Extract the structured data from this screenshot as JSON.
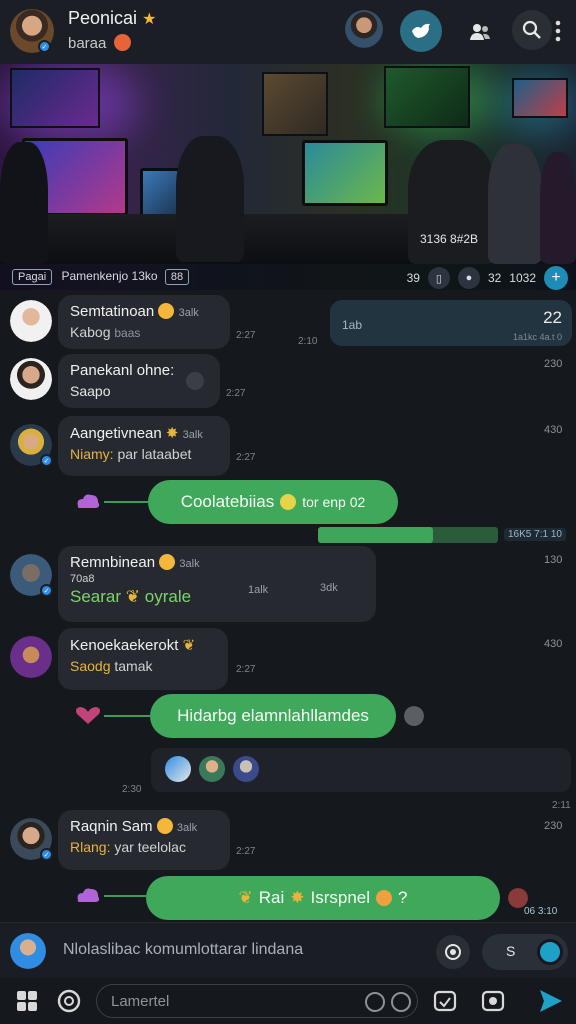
{
  "header": {
    "title": "Peonicai",
    "title_emoji": "★",
    "subtitle": "baraa"
  },
  "banner": {
    "left_label": "Pagai",
    "left_text": "Pamenkenjo",
    "left_chip1": "13ko",
    "left_chip2": "88",
    "stamp": "3136 8#2B",
    "right_count1": "39",
    "right_count2": "32",
    "right_count3": "1032"
  },
  "messages": [
    {
      "name": "Semtatinoan",
      "tag": "3alk",
      "body": "Kabog",
      "body2": "baas",
      "time": "2:27"
    },
    {
      "name": "Panekanl ohne:",
      "body": "Saapo",
      "time": "2:27"
    },
    {
      "name": "Aangetivnean",
      "tag": "3alk",
      "body": "Niamy:",
      "body2": "par lataabet",
      "time": "2:27"
    },
    {
      "name": "Remnbinean",
      "tag": "3alk",
      "body_line": "70a8",
      "body": "Searar",
      "body2": "oyrale",
      "meta1": "1alk",
      "meta2": "3dk"
    },
    {
      "name": "Kenoekaekerokt",
      "body": "Saodg",
      "body2": "tamak",
      "time": "2:27"
    },
    {
      "name": "Raqnin Sam",
      "tag": "3alk",
      "body": "Rlang:",
      "body2": "yar teelolac",
      "time": "2:27"
    }
  ],
  "right_times": [
    "230",
    "230",
    "430",
    "130",
    "430",
    "230"
  ],
  "outgoing": {
    "text": "1ab",
    "count": "22",
    "sub": "1a1kc 4a.t 0"
  },
  "outgoing_time": "2:10",
  "green_messages": [
    {
      "text": "Coolatebiias",
      "tail": "tor enp 02"
    },
    {
      "text": "Hidarbg elamnlahllamdes"
    },
    {
      "text": "Rai",
      "tail": "Isrspnel",
      "tail2": "?"
    }
  ],
  "progress": {
    "label": "16K5 7:1 10",
    "fill": 0.64
  },
  "strip_time": "2:30",
  "strip_side_time": "2:11",
  "last_time": "2:11",
  "last_time_right": "06 3:10",
  "composer": {
    "text": "Nlolaslibac komumlottarar lindana",
    "toggle_label": "S"
  },
  "bottom": {
    "input_placeholder": "Lamertel"
  },
  "colors": {
    "accent": "#3fa85a",
    "brand": "#1fa1c7",
    "background": "#15181d"
  },
  "icons": [
    "verified-badge-icon",
    "bird-icon",
    "people-icon",
    "search-icon",
    "more-vertical-icon",
    "plus-icon",
    "camera-icon",
    "send-icon",
    "home-icon",
    "chat-icon",
    "image-icon",
    "sticker-icon",
    "emoji-icon"
  ]
}
